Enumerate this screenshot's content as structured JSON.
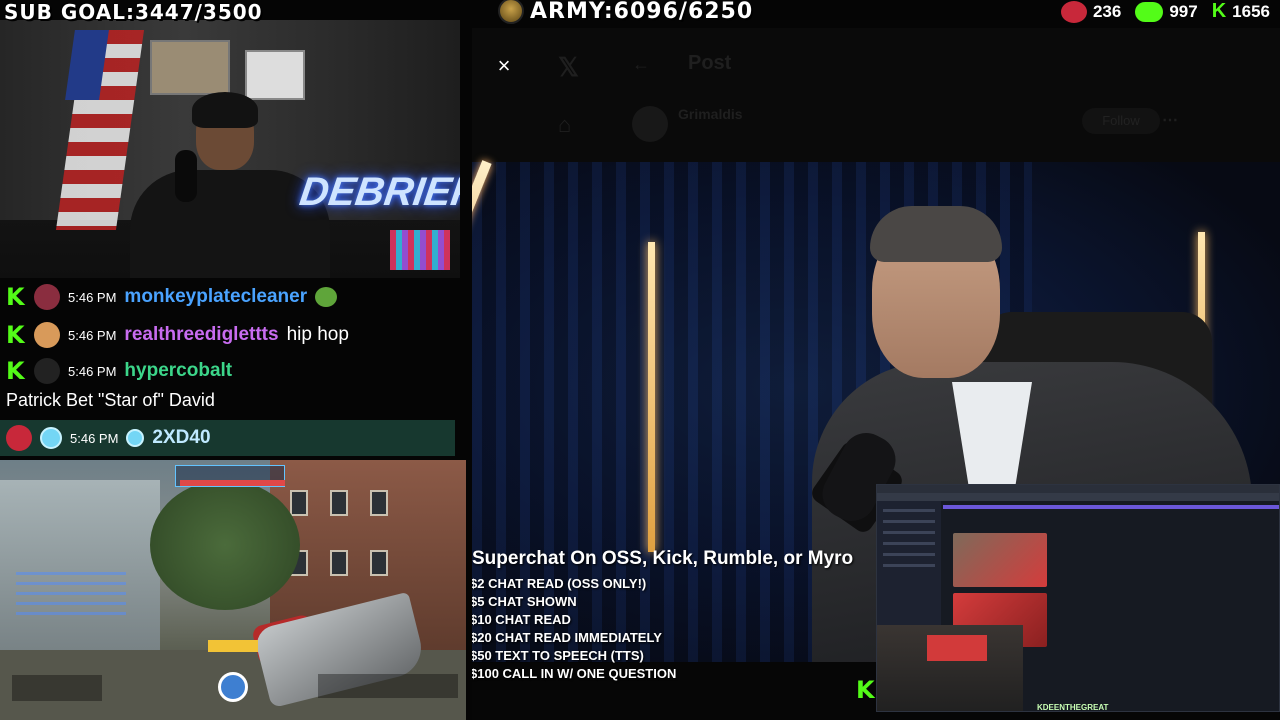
{
  "overlay": {
    "sub_goal": "SUB GOAL:3447/3500",
    "army": "ARMY:6096/6250",
    "counters": [
      {
        "icon": "red-badge-icon",
        "value": "236"
      },
      {
        "icon": "rumble-play-icon",
        "value": "997"
      },
      {
        "icon": "kick-k-icon",
        "value": "1656"
      }
    ],
    "colors": {
      "kick_green": "#53fc18",
      "rumble_green": "#85c742",
      "badge_red": "#c8283a"
    }
  },
  "webcam": {
    "neon_sign": "DEBRIEF"
  },
  "chat": {
    "messages": [
      {
        "platform": "kick",
        "time": "5:46 PM",
        "username": "monkeyplatecleaner",
        "username_color": "#4aa3ff",
        "text": ""
      },
      {
        "platform": "kick",
        "time": "5:46 PM",
        "username": "realthreediglettts",
        "username_color": "#c86cf0",
        "text": "hip hop"
      },
      {
        "platform": "kick",
        "time": "5:46 PM",
        "username": "hypercobalt",
        "username_color": "#3cd68a",
        "text": ""
      }
    ],
    "full_line": "Patrick Bet \"Star of\" David",
    "highlight": {
      "time": "5:46 PM",
      "username": "2XD40"
    }
  },
  "video": {
    "close_label": "×",
    "ghost_header": {
      "back": "←",
      "title": "Post",
      "name": "Grimaldis",
      "follow": "Follow"
    },
    "superchat": {
      "title": "Superchat On OSS, Kick, Rumble, or Myro",
      "items": [
        "$2 CHAT READ (OSS ONLY!)",
        "$5 CHAT SHOWN",
        "$10 CHAT READ",
        "$20 CHAT READ IMMEDIATELY",
        "$50 TEXT TO SPEECH (TTS)",
        "$100 CALL IN W/ ONE QUESTION"
      ]
    }
  },
  "pip": {
    "footer": "KDEENTHEGREAT"
  }
}
